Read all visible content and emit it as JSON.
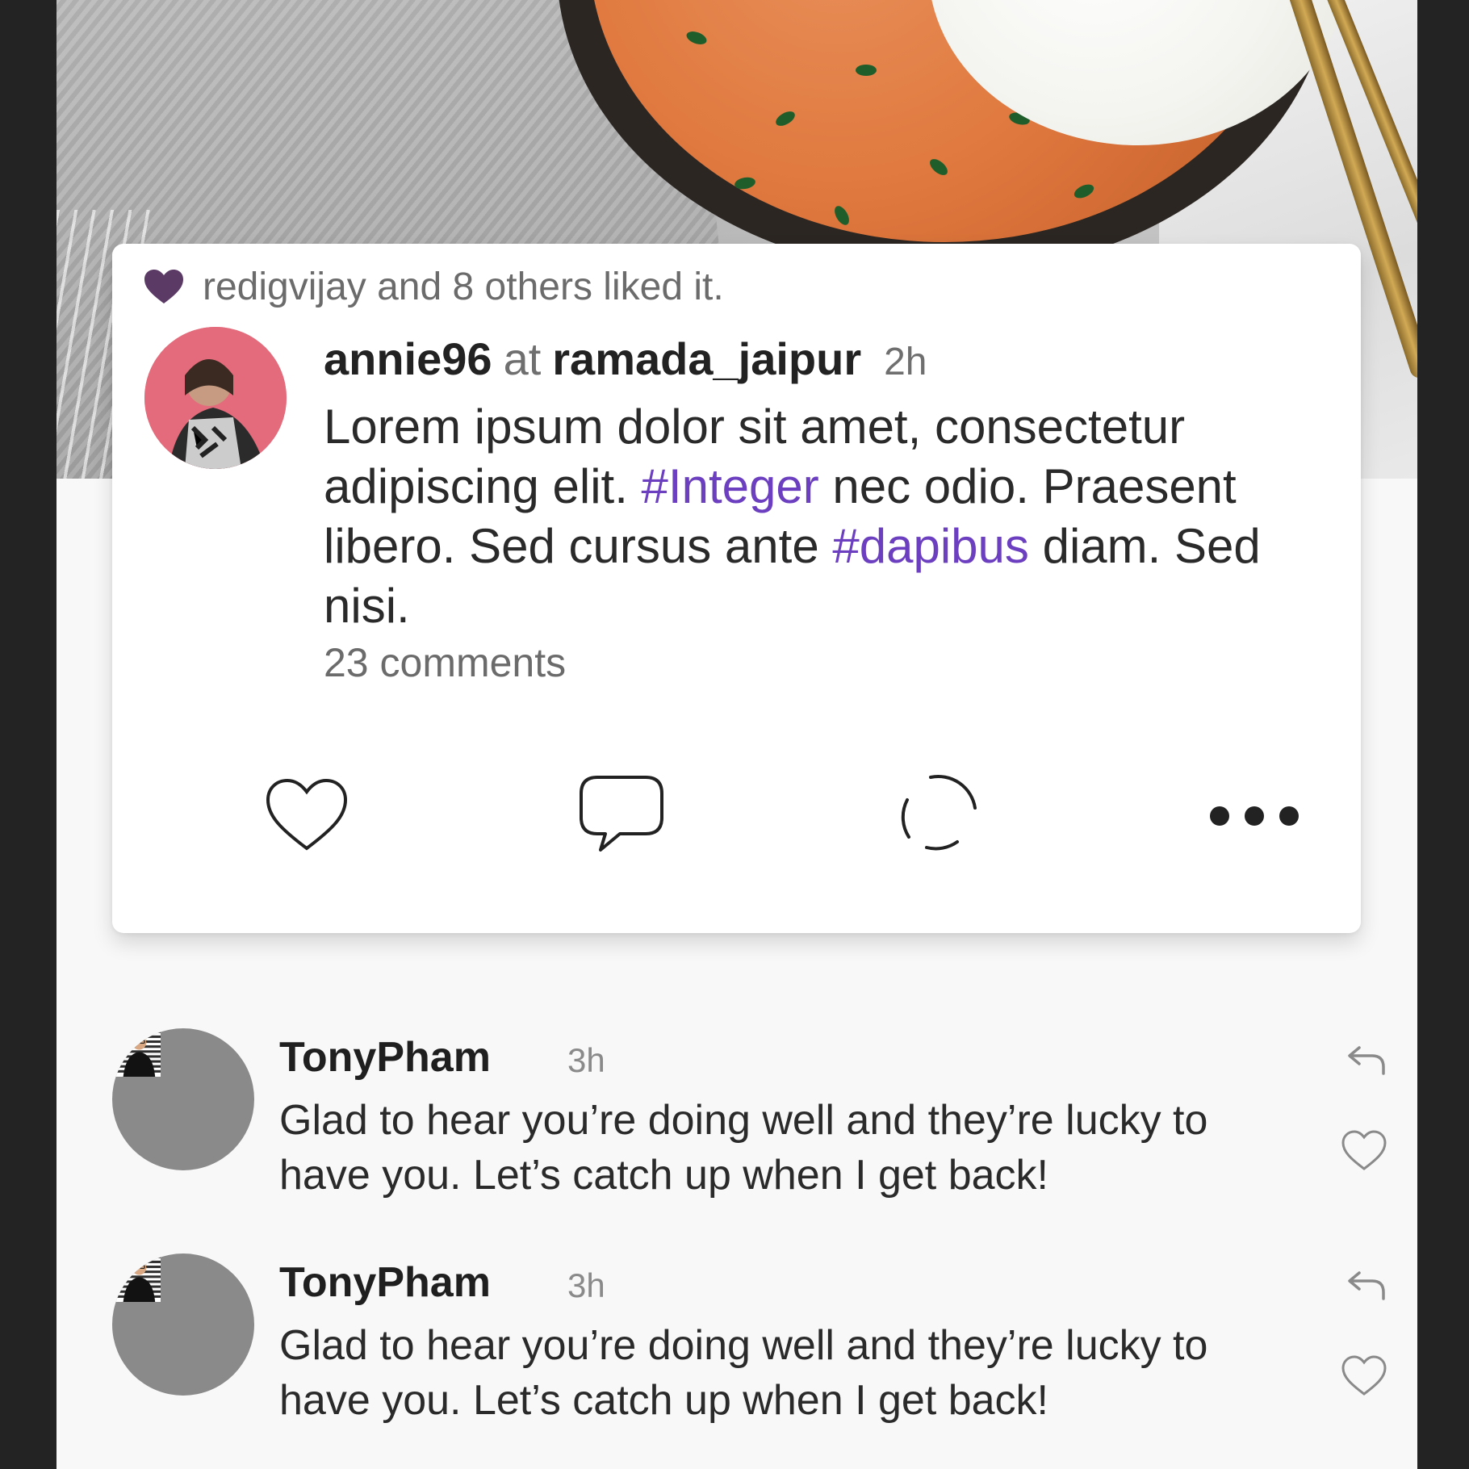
{
  "post": {
    "likes_text": "redigvijay and 8 others liked it.",
    "author": "annie96",
    "at_word": "at",
    "location": "ramada_jaipur",
    "time": "2h",
    "body": {
      "part1": "Lorem ipsum dolor sit amet, consectetur adipiscing elit. ",
      "hashtag1": "#Integer",
      "part2": " nec odio. Praesent libero. Sed cursus ante ",
      "hashtag2": "#dapibus",
      "part3": " diam. Sed nisi."
    },
    "comments_count": "23 comments",
    "actions": {
      "like_icon": "heart-outline-icon",
      "comment_icon": "speech-bubble-icon",
      "share_icon": "loading-ring-icon",
      "more_icon": "more-dots-icon"
    }
  },
  "comments": [
    {
      "name": "TonyPham",
      "time": "3h",
      "text": "Glad to hear you’re doing well and they’re lucky to have you. Let’s catch up when I get back!"
    },
    {
      "name": "TonyPham",
      "time": "3h",
      "text": "Glad to hear you’re doing well and they’re lucky to have you. Let’s catch up when I get back!"
    }
  ],
  "colors": {
    "accent_purple": "#6b3fc0",
    "liked_heart": "#5b3a66",
    "background_frame": "#232323",
    "screen_bg": "#f8f8f8"
  }
}
